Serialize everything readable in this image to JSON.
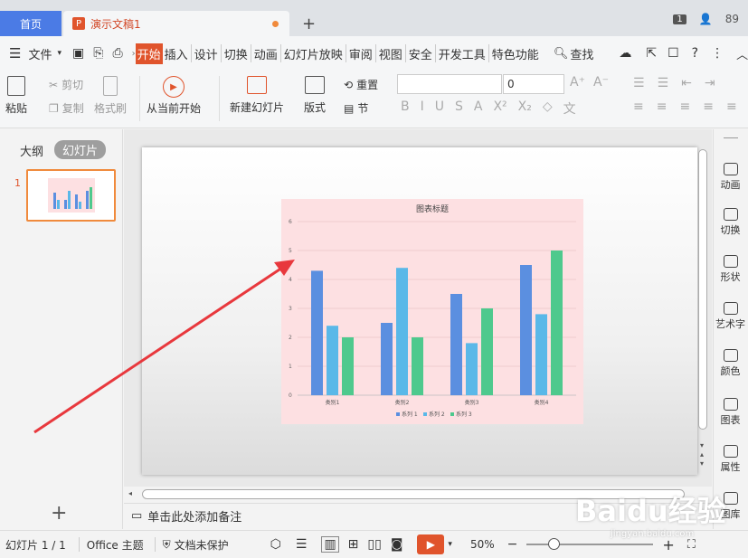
{
  "tabs": {
    "home": "首页",
    "doc": "演示文稿1",
    "count_badge": "1",
    "user_num": "89"
  },
  "menu": {
    "file": "文件",
    "items": [
      "开始",
      "插入",
      "设计",
      "切换",
      "动画",
      "幻灯片放映",
      "审阅",
      "视图",
      "安全",
      "开发工具",
      "特色功能"
    ],
    "search": "查找"
  },
  "ribbon": {
    "paste": "粘贴",
    "cut": "剪切",
    "copy": "复制",
    "format_painter": "格式刷",
    "play_from_current": "从当前开始",
    "new_slide": "新建幻灯片",
    "layout": "版式",
    "reset": "重置",
    "section": "节",
    "font_name": "",
    "font_size": "0"
  },
  "left_panel": {
    "outline": "大纲",
    "slides": "幻灯片",
    "slide_number": "1"
  },
  "notes_placeholder": "单击此处添加备注",
  "right_panel": [
    "动画",
    "切换",
    "形状",
    "艺术字",
    "颜色",
    "图表",
    "属性",
    "图库"
  ],
  "status": {
    "slide_info": "幻灯片 1 / 1",
    "theme": "Office 主题",
    "protection": "文档未保护",
    "zoom": "50%"
  },
  "watermark": {
    "main": "Baidu经验",
    "sub": "jingyan.baidu.com"
  },
  "colors": {
    "accent": "#e0542c",
    "home_tab": "#4b7be5",
    "arrow": "#e8383d",
    "chart_bg": "#fde0e2"
  },
  "chart_data": {
    "type": "bar",
    "title": "图表标题",
    "categories": [
      "类别1",
      "类别2",
      "类别3",
      "类别4"
    ],
    "series": [
      {
        "name": "系列 1",
        "values": [
          4.3,
          2.5,
          3.5,
          4.5
        ],
        "color": "#5b8fe0"
      },
      {
        "name": "系列 2",
        "values": [
          2.4,
          4.4,
          1.8,
          2.8
        ],
        "color": "#5ab8e8"
      },
      {
        "name": "系列 3",
        "values": [
          2.0,
          2.0,
          3.0,
          5.0
        ],
        "color": "#4ec98d"
      }
    ],
    "ylim": [
      0,
      6
    ],
    "yticks": [
      0,
      1,
      2,
      3,
      4,
      5,
      6
    ],
    "grid": true,
    "legend": "bottom"
  }
}
